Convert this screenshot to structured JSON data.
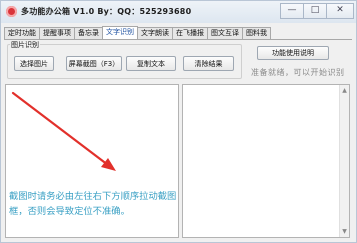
{
  "window": {
    "title": "多功能办公箱 V1.0   By：QQ：525293680",
    "controls": {
      "minimize": "—",
      "maximize": "□",
      "close": "✕"
    }
  },
  "tabs": [
    {
      "label": "定时功能",
      "active": false
    },
    {
      "label": "提醒事项",
      "active": false
    },
    {
      "label": "备忘录",
      "active": false
    },
    {
      "label": "文字识别",
      "active": true
    },
    {
      "label": "文字朗读",
      "active": false
    },
    {
      "label": "在飞播报",
      "active": false
    },
    {
      "label": "图文互译",
      "active": false
    },
    {
      "label": "图料我",
      "active": false
    }
  ],
  "ocr_group": {
    "title": "图片识别",
    "buttons": {
      "select_image": "选择图片",
      "screen_capture": "屏幕截图（F3）",
      "copy_text": "复制文本",
      "clear_result": "清除结果"
    }
  },
  "help_button": "功能使用说明",
  "status": "准备就绪，可以开始识别",
  "instruction": "截图时请务必由左往右下方顺序拉动截图框，否则会导致定位不准确。",
  "colors": {
    "accent": "#1b4fa0",
    "instruction": "#3aa0c4",
    "arrow": "#e2302b"
  }
}
